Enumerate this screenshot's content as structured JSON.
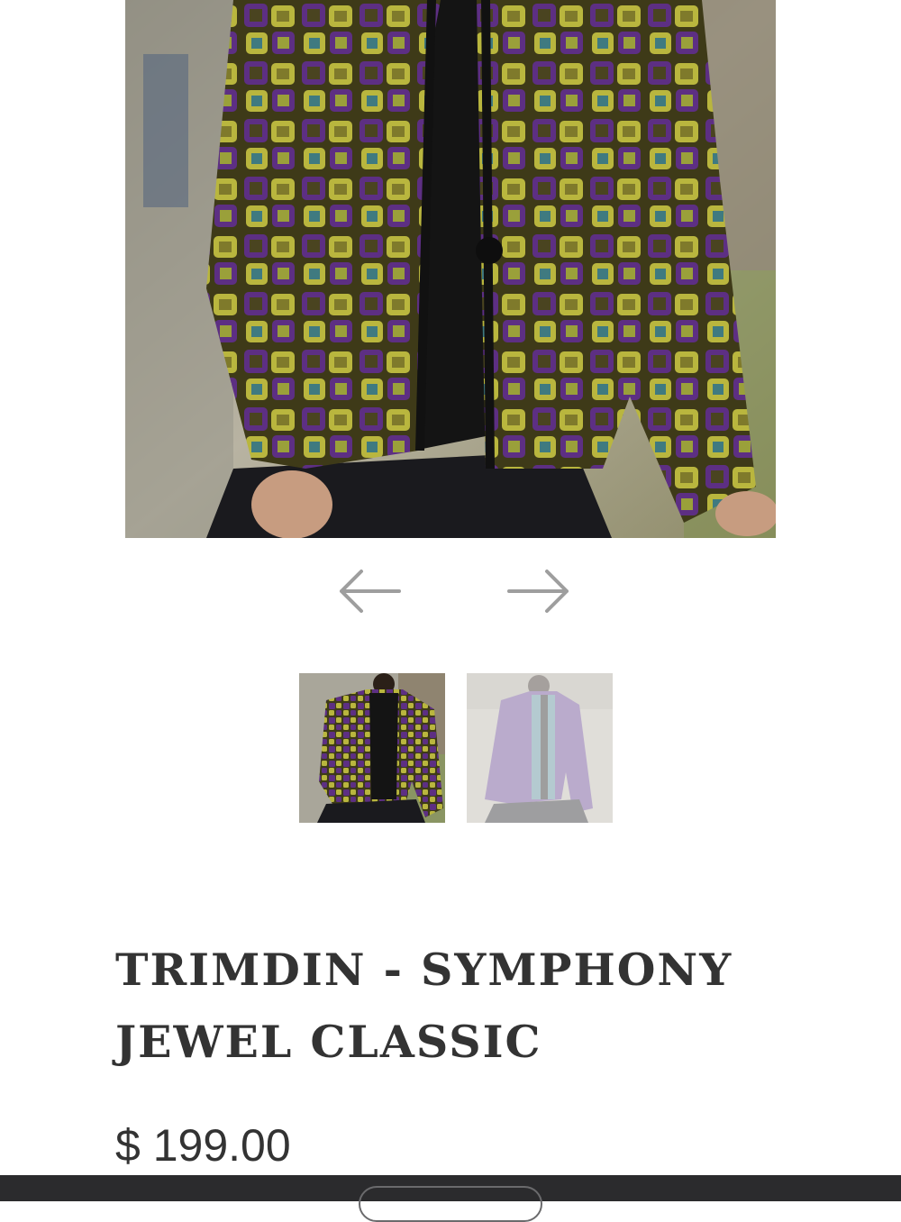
{
  "product": {
    "title": "TRIMDIN - SYMPHONY JEWEL CLASSIC",
    "price": "$ 199.00"
  },
  "gallery": {
    "main_image_subject": "patterned-jacket-photo",
    "prev_icon": "arrow-left-icon",
    "next_icon": "arrow-right-icon",
    "thumbnail_count": 2,
    "active_thumbnail": 1
  },
  "colors": {
    "text": "#333333",
    "arrow": "#9e9e9e",
    "bottom_bar": "#2b2b2d",
    "jacket_base": "#3e3a18",
    "jacket_purple": "#5d2f83",
    "jacket_yellow": "#b9b63e",
    "jacket_teal": "#3f7a80"
  }
}
